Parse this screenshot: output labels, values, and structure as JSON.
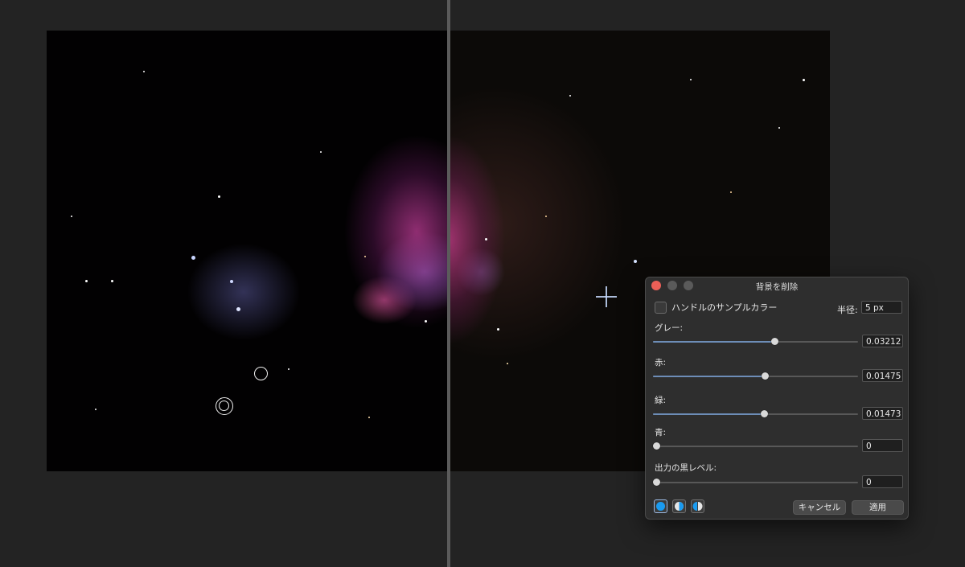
{
  "dialog": {
    "title": "背景を削除",
    "handle_sample_color_label": "ハンドルのサンプルカラー",
    "handle_sample_color_checked": false,
    "radius_label": "半径:",
    "radius_value": "5 px",
    "sliders": [
      {
        "label": "グレー:",
        "value": "0.03212",
        "position": 0.575
      },
      {
        "label": "赤:",
        "value": "0.01475",
        "position": 0.53
      },
      {
        "label": "緑:",
        "value": "0.01473",
        "position": 0.525
      },
      {
        "label": "青:",
        "value": "0",
        "position": 0.0
      },
      {
        "label": "出力の黒レベル:",
        "value": "0",
        "position": 0.0
      }
    ],
    "cancel_label": "キャンセル",
    "apply_label": "適用"
  },
  "icons": {
    "close": "close-icon",
    "minimize": "minimize-icon",
    "maximize": "maximize-icon",
    "mode_full": "full-circle-icon",
    "mode_split": "half-circle-icon",
    "mode_mirror": "mirror-half-circle-icon"
  },
  "colors": {
    "accent": "#6d8db7",
    "close_button": "#ed5f57",
    "mode_icon": "#1a9bf0"
  }
}
